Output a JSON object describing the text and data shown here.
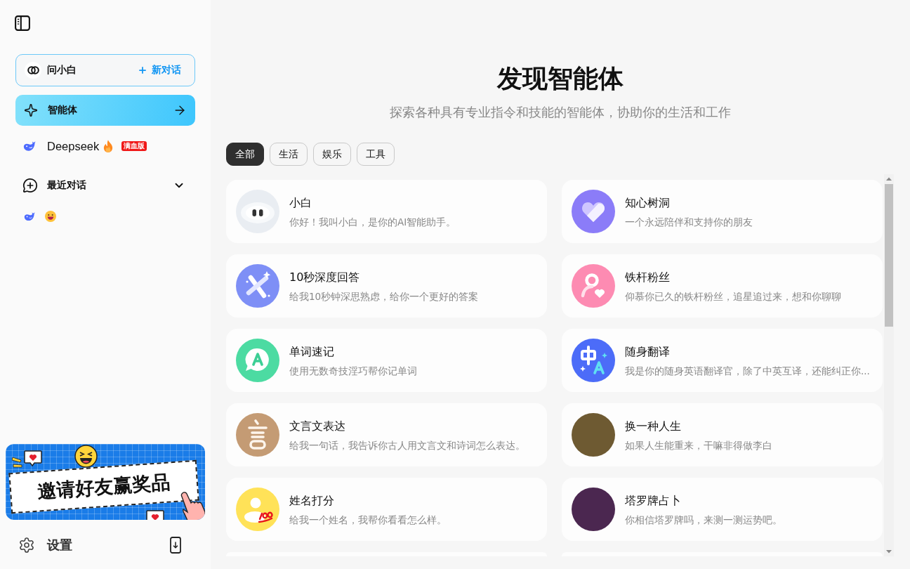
{
  "sidebar": {
    "assistant": {
      "label": "问小白",
      "new_chat": "新对话"
    },
    "nav": [
      {
        "kind": "agents",
        "label": "智能体",
        "selected": true
      },
      {
        "kind": "model",
        "label": "Deepseek",
        "badge": "满血版",
        "selected": false
      }
    ],
    "recent": {
      "label": "最近对话",
      "expanded": true,
      "items": [
        {
          "kind": "emoji",
          "selected": false
        }
      ]
    },
    "banner": {
      "text": "邀请好友赢奖品"
    },
    "settings": {
      "label": "设置"
    }
  },
  "main": {
    "title": "发现智能体",
    "subtitle": "探索各种具有专业指令和技能的智能体，协助你的生活和工作",
    "filters": [
      {
        "label": "全部",
        "selected": true
      },
      {
        "label": "生活",
        "selected": false
      },
      {
        "label": "娱乐",
        "selected": false
      },
      {
        "label": "工具",
        "selected": false
      }
    ],
    "agents": [
      {
        "name": "小白",
        "description": "你好！我叫小白，是你的AI智能助手。",
        "kind": "robot",
        "color": "#e9edf2"
      },
      {
        "name": "知心树洞",
        "description": "一个永远陪伴和支持你的朋友",
        "kind": "heart",
        "color": "#8b7cf8"
      },
      {
        "name": "10秒深度回答",
        "description": "给我10秒钟深思熟虑，给你一个更好的答案",
        "kind": "cross",
        "color": "#7e8ff6"
      },
      {
        "name": "铁杆粉丝",
        "description": "仰慕你已久的铁杆粉丝，追星追过来，想和你聊聊",
        "kind": "fan",
        "color": "#fd8bb2"
      },
      {
        "name": "单词速记",
        "description": "使用无数奇技淫巧帮你记单词",
        "kind": "word",
        "color": "#4cdba2"
      },
      {
        "name": "随身翻译",
        "description": "我是你的随身英语翻译官，除了中英互译，还能纠正你...",
        "kind": "translate",
        "color": "#4c6cf8"
      },
      {
        "name": "文言文表达",
        "description": "给我一句话，我告诉你古人用文言文和诗词怎么表达。",
        "kind": "classical",
        "color": "#c49b74"
      },
      {
        "name": "换一种人生",
        "description": "如果人生能重来，干嘛非得做李白",
        "kind": "photo",
        "color": "#6e5a32"
      },
      {
        "name": "姓名打分",
        "description": "给我一个姓名，我帮你看看怎么样。",
        "kind": "score",
        "color": "#ffe258"
      },
      {
        "name": "塔罗牌占卜",
        "description": "你相信塔罗牌吗，来测一测运势吧。",
        "kind": "photo",
        "color": "#4b2750"
      }
    ]
  }
}
